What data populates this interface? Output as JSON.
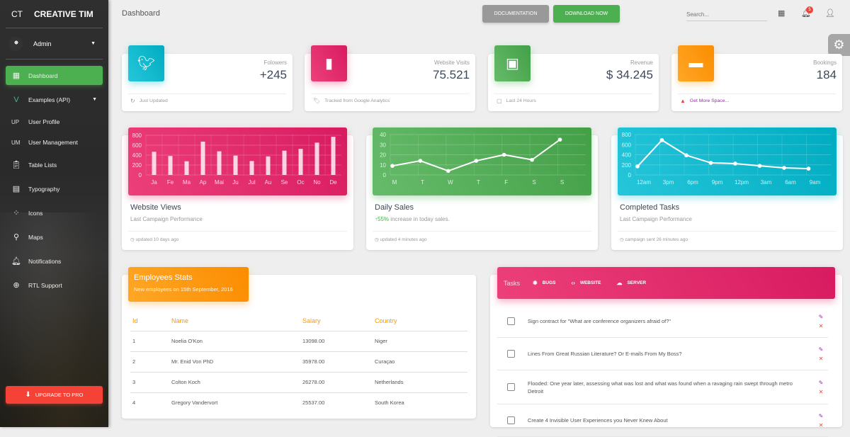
{
  "brand": {
    "mini": "CT",
    "name": "CREATIVE TIM"
  },
  "user": {
    "name": "Admin"
  },
  "sidebar": {
    "items": [
      {
        "label": "Dashboard",
        "icon": "dashboard-icon"
      },
      {
        "label": "Examples (API)",
        "icon": "vue-laravel-icon"
      },
      {
        "label": "User Profile",
        "abbr": "UP"
      },
      {
        "label": "User Management",
        "abbr": "UM"
      },
      {
        "label": "Table Lists",
        "icon": "clipboard-icon"
      },
      {
        "label": "Typography",
        "icon": "library-books-icon"
      },
      {
        "label": "Icons",
        "icon": "bubble-chart-icon"
      },
      {
        "label": "Maps",
        "icon": "location-pin-icon"
      },
      {
        "label": "Notifications",
        "icon": "bell-icon"
      },
      {
        "label": "RTL Support",
        "icon": "globe-icon"
      }
    ],
    "upgrade_label": "UPGRADE TO PRO"
  },
  "topbar": {
    "title": "Dashboard",
    "documentation_label": "DOCUMENTATION",
    "download_label": "DOWNLOAD NOW",
    "search_placeholder": "Search...",
    "notification_count": "5"
  },
  "stats": [
    {
      "category": "Folowers",
      "value": "+245",
      "footer": "Just Updated",
      "icon": "twitter-icon",
      "footer_icon": "refresh-icon"
    },
    {
      "category": "Website Visits",
      "value": "75.521",
      "footer": "Tracked from Google Analytics",
      "icon": "bar-chart-icon",
      "footer_icon": "tag-icon"
    },
    {
      "category": "Revenue",
      "value": "$ 34.245",
      "footer": "Last 24 Hours",
      "icon": "store-icon",
      "footer_icon": "calendar-icon"
    },
    {
      "category": "Bookings",
      "value": "184",
      "footer": "Get More Space...",
      "icon": "sofa-icon",
      "footer_icon": "warning-icon"
    }
  ],
  "chart_data": [
    {
      "type": "bar",
      "title": "Website Views",
      "subtitle": "Last Campaign Performance",
      "footer": "updated 10 days ago",
      "categories": [
        "Ja",
        "Fe",
        "Ma",
        "Ap",
        "Mai",
        "Ju",
        "Jul",
        "Au",
        "Se",
        "Oc",
        "No",
        "De"
      ],
      "values": [
        542,
        443,
        320,
        780,
        553,
        453,
        326,
        434,
        568,
        610,
        756,
        895
      ],
      "yticks": [
        0,
        200,
        400,
        600,
        800
      ],
      "ylim": [
        0,
        900
      ],
      "grid": true
    },
    {
      "type": "line",
      "title": "Daily Sales",
      "subtitle_highlight": "55%",
      "subtitle": "increase in today sales.",
      "footer": "updated 4 minutes ago",
      "categories": [
        "M",
        "T",
        "W",
        "T",
        "F",
        "S",
        "S"
      ],
      "values": [
        9,
        14,
        4,
        14,
        20,
        15,
        35
      ],
      "yticks": [
        0,
        10,
        20,
        30,
        40
      ],
      "ylim": [
        0,
        40
      ],
      "grid": true
    },
    {
      "type": "line",
      "title": "Completed Tasks",
      "subtitle": "Last Campaign Performance",
      "footer": "campaign sent 26 minutes ago",
      "categories": [
        "12am",
        "3pm",
        "6pm",
        "9pm",
        "12pm",
        "3am",
        "6am",
        "9am"
      ],
      "values": [
        170,
        690,
        390,
        240,
        225,
        180,
        140,
        125
      ],
      "yticks": [
        0,
        200,
        400,
        600,
        800
      ],
      "ylim": [
        0,
        800
      ],
      "grid": true
    }
  ],
  "employees": {
    "title": "Employees Stats",
    "subtitle": "New employees on 15th September, 2016",
    "columns": [
      "Id",
      "Name",
      "Salary",
      "Country"
    ],
    "rows": [
      [
        "1",
        "Noelia O'Kon",
        "13098.00",
        "Niger"
      ],
      [
        "2",
        "Mr. Enid Von PhD",
        "35978.00",
        "Curaçao"
      ],
      [
        "3",
        "Colton Koch",
        "26278.00",
        "Netherlands"
      ],
      [
        "4",
        "Gregory Vandervort",
        "25537.00",
        "South Korea"
      ]
    ]
  },
  "tasks": {
    "label": "Tasks",
    "tabs": [
      {
        "label": "BUGS",
        "icon": "bug-icon"
      },
      {
        "label": "WEBSITE",
        "icon": "code-icon"
      },
      {
        "label": "SERVER",
        "icon": "cloud-icon"
      }
    ],
    "items": [
      {
        "text": "Sign contract for \"What are conference organizers afraid of?\"",
        "checked": false
      },
      {
        "text": "Lines From Great Russian Literature? Or E-mails From My Boss?",
        "checked": false
      },
      {
        "text": "Flooded: One year later, assessing what was lost and what was found when a ravaging rain swept through metro Detroit",
        "checked": false
      },
      {
        "text": "Create 4 Invisible User Experiences you Never Knew About",
        "checked": false
      }
    ]
  },
  "colors": {
    "primary_green": "#4caf50",
    "pink": "#e91e63",
    "cyan": "#00bcd4",
    "orange": "#ff9800",
    "danger": "#f44336",
    "edit": "#9c27b0"
  }
}
